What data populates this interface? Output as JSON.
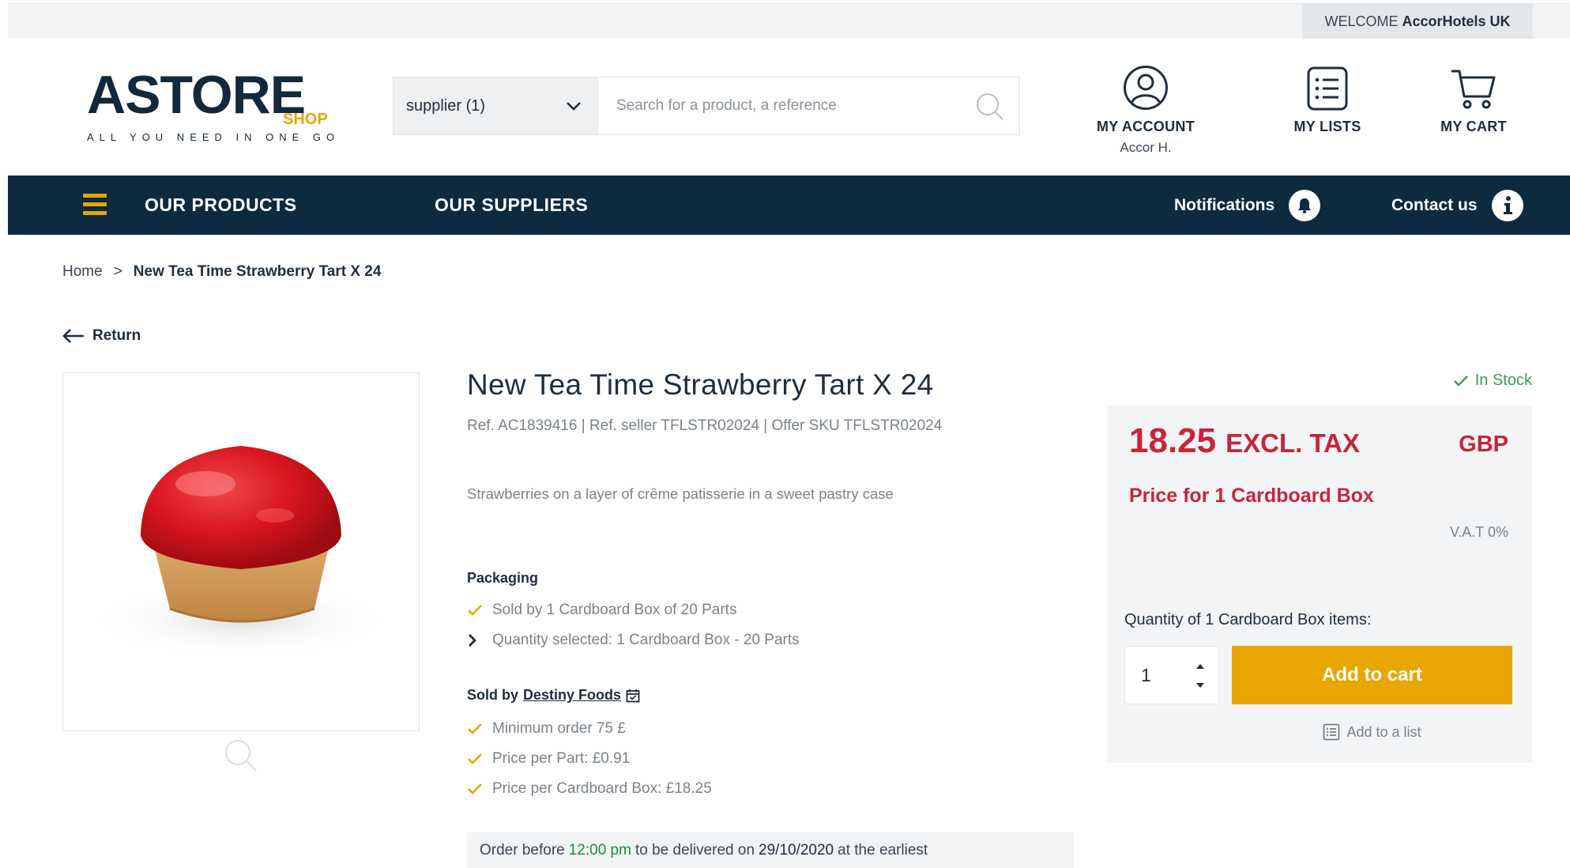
{
  "topbar": {
    "welcome_prefix": "WELCOME",
    "welcome_name": "AccorHotels UK"
  },
  "logo": {
    "main": "ASTORE",
    "shop": "SHOP",
    "tagline": "ALL YOU NEED IN ONE GO"
  },
  "search": {
    "supplier_label": "supplier (1)",
    "placeholder": "Search for a product, a reference"
  },
  "header": {
    "account_label": "MY ACCOUNT",
    "account_user": "Accor H.",
    "lists_label": "MY LISTS",
    "cart_label": "MY CART"
  },
  "nav": {
    "products": "OUR PRODUCTS",
    "suppliers": "OUR SUPPLIERS",
    "notifications": "Notifications",
    "contact": "Contact us"
  },
  "breadcrumb": {
    "home": "Home",
    "separator": ">",
    "current": "New Tea Time Strawberry Tart X 24"
  },
  "return_label": "Return",
  "product": {
    "title": "New Tea Time Strawberry Tart X 24",
    "refs": "Ref. AC1839416 | Ref. seller TFLSTR02024 | Offer SKU TFLSTR02024",
    "description": "Strawberries on a layer of crême patisserie in a sweet pastry case",
    "packaging_title": "Packaging",
    "packaging_sold_by": "Sold by 1 Cardboard Box of 20 Parts",
    "packaging_quantity": "Quantity selected: 1 Cardboard Box - 20 Parts",
    "sold_by_label": "Sold by",
    "seller": "Destiny Foods",
    "min_order": "Minimum order 75 £",
    "price_per_part": "Price per Part: £0.91",
    "price_per_box": "Price per Cardboard Box: £18.25"
  },
  "delivery": {
    "prefix": "Order before",
    "time": "12:00 pm",
    "middle": "to be delivered on",
    "date": "29/10/2020",
    "suffix": "at the earliest"
  },
  "pricing": {
    "stock": "In Stock",
    "price": "18.25",
    "tax_label": "EXCL. TAX",
    "currency": "GBP",
    "price_for": "Price for 1 Cardboard Box",
    "vat": "V.A.T 0%",
    "quantity_label": "Quantity of 1 Cardboard Box items:",
    "quantity_value": "1",
    "add_to_cart": "Add to cart",
    "add_to_list": "Add to a list"
  },
  "colors": {
    "navy": "#0d2a3f",
    "accent": "#e8a600",
    "price_red": "#c8243c",
    "stock_green": "#3d9a5a"
  }
}
